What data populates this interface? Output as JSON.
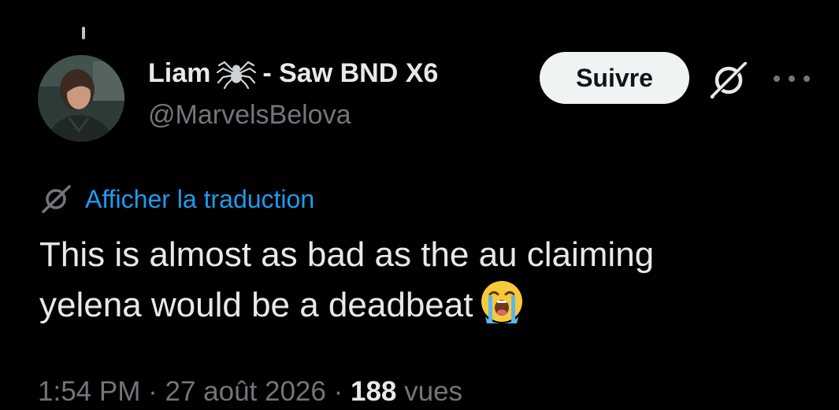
{
  "tweet": {
    "author": {
      "display_name": "Liam",
      "name_suffix": "- Saw BND X6",
      "name_emoji": "spider-icon",
      "handle": "@MarvelsBelova",
      "avatar": "avatar"
    },
    "follow_label": "Suivre",
    "translate_label": "Afficher la traduction",
    "text_line1": "This is almost as bad as the au claiming",
    "text_line2": "yelena would be a deadbeat",
    "text_emoji": "loudly-crying-face-icon",
    "time": "1:54 PM",
    "separator": "·",
    "date": "27 août 2026",
    "views_count": "188",
    "views_label": "vues"
  },
  "colors": {
    "background": "#000000",
    "text_primary": "#e7e9ea",
    "text_secondary": "#71767b",
    "link": "#1d9bf0",
    "button_bg": "#eff3f4",
    "button_text": "#0f1419"
  }
}
